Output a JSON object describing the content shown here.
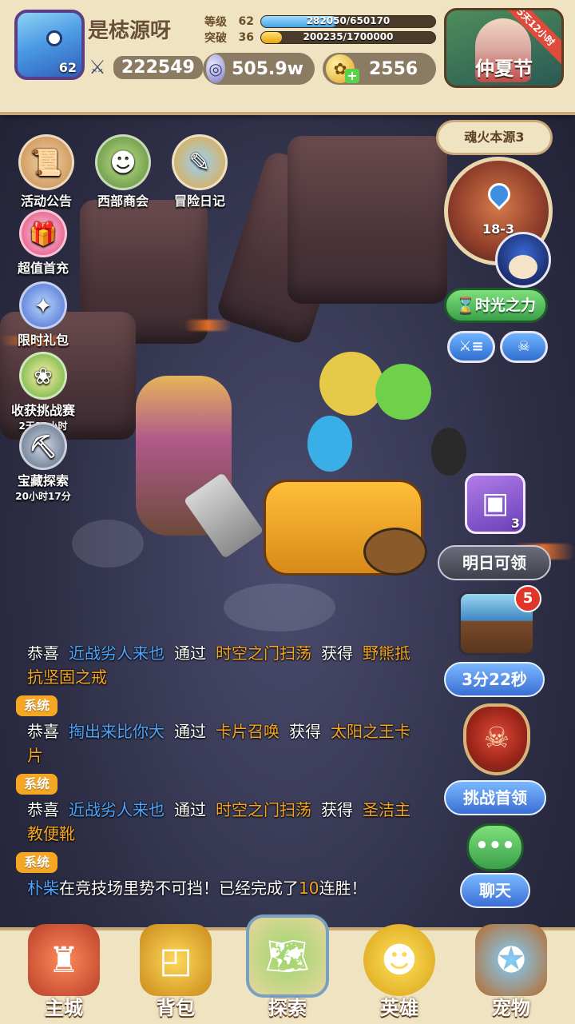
{
  "top_bar": {
    "avatar_level": "62",
    "player_name": "是梽源呀",
    "power": "222549",
    "level_bar": {
      "label": "等级",
      "value": "62",
      "text": "282050/650170",
      "fill": 0.434
    },
    "break_bar": {
      "label": "突破",
      "value": "36",
      "text": "200235/1700000",
      "fill": 0.118
    },
    "silver": "505.9w",
    "gold": "2556",
    "event": {
      "label": "仲夏节",
      "ribbon": "5天12小时"
    }
  },
  "left_menu": {
    "activity": "活动公告",
    "merchant": "西部商会",
    "diary": "冒险日记",
    "first_charge": "超值首充",
    "gift": "限时礼包",
    "harvest": {
      "label": "收获挑战赛",
      "sub": "2天12小时"
    },
    "treasure": {
      "label": "宝藏探索",
      "sub": "20小时17分"
    }
  },
  "right_panel": {
    "stage_title": "魂火本源3",
    "stage_level": "18-3",
    "time_power": "时光之力",
    "chest_count": "3",
    "chest_tomorrow": "明日可领",
    "reward_badge": "5",
    "reward_timer": "3分22秒",
    "boss": "挑战首领",
    "chat": "聊天"
  },
  "chat": {
    "sys_tag": "系统",
    "partial_line": {
      "a": "恭喜",
      "player": "近战劣人来也",
      "via": "通过",
      "method": "时空之门扫荡",
      "get": "获得",
      "item": "野熊抵"
    },
    "partial_line_cont": "抗坚固之戒",
    "msg1": {
      "a": "恭喜",
      "player": "掏出来比你大",
      "via": "通过",
      "method": "卡片召唤",
      "get": "获得",
      "item": "太阳之王卡",
      "item_cont": "片"
    },
    "msg2": {
      "a": "恭喜",
      "player": "近战劣人来也",
      "via": "通过",
      "method": "时空之门扫荡",
      "get": "获得",
      "item": "圣洁主",
      "item_cont": "教便靴"
    },
    "msg3": {
      "player": "朴柴",
      "text1": "在竞技场里势不可挡！已经完成了",
      "num": "10",
      "text2": "连胜！"
    }
  },
  "bottom_nav": {
    "home": "主城",
    "bag": "背包",
    "explore": "探索",
    "hero": "英雄",
    "pet": "宠物"
  },
  "colors": {
    "player_name_in_chat": "#4ea7ff",
    "highlight": "#f5a623",
    "system_tag": "#f5a623"
  }
}
